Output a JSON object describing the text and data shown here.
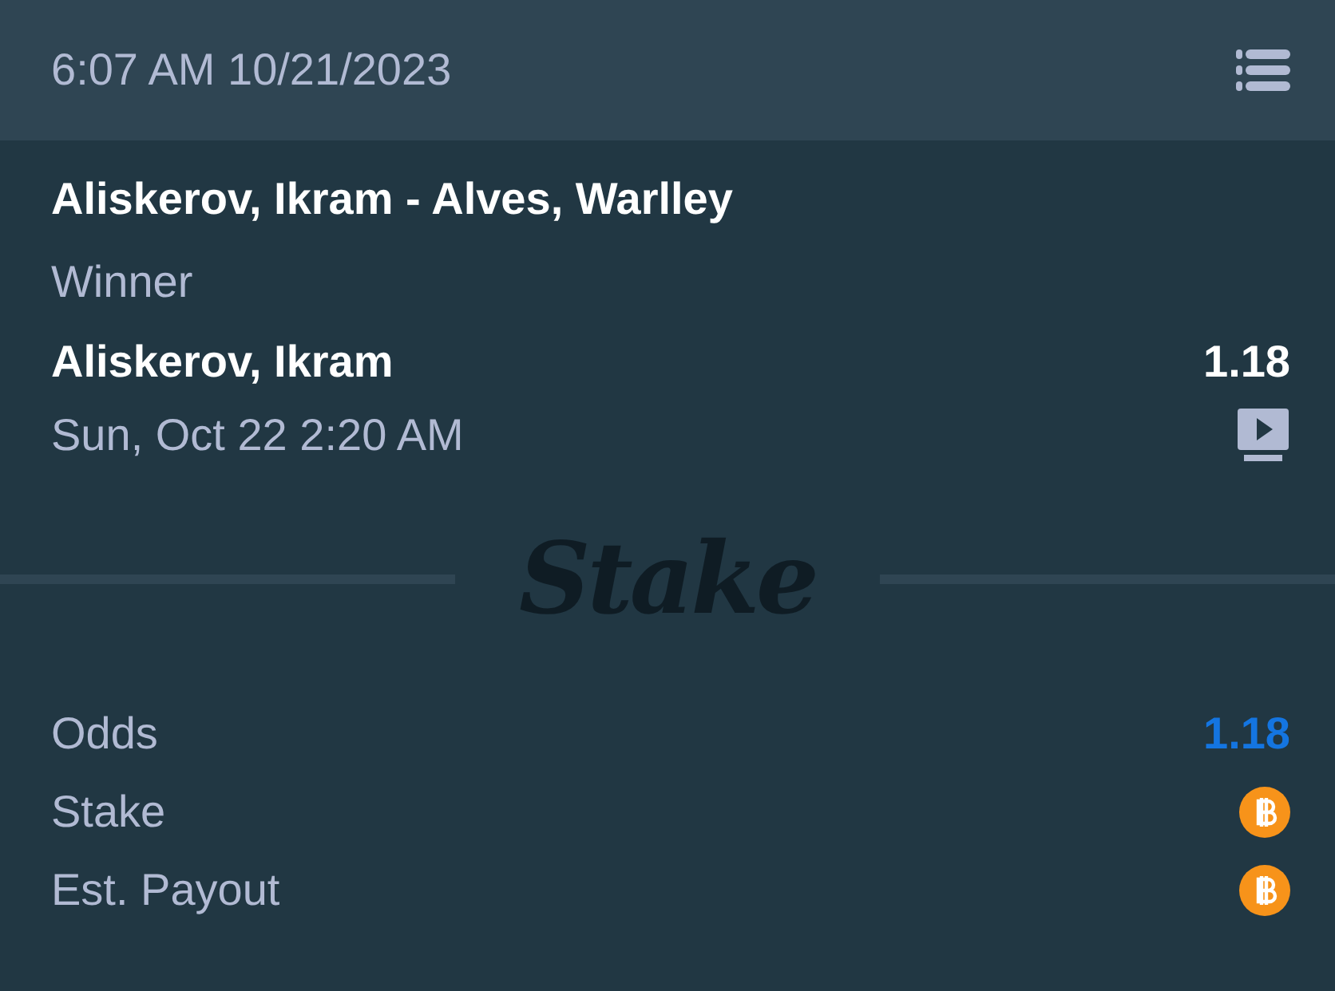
{
  "header": {
    "datetime": "6:07 AM 10/21/2023"
  },
  "bet": {
    "event": "Aliskerov, Ikram - Alves, Warlley",
    "market": "Winner",
    "selection": "Aliskerov, Ikram",
    "odds": "1.18",
    "start_time": "Sun, Oct 22 2:20 AM",
    "live_stream": true
  },
  "divider_logo": "Stake",
  "summary": [
    {
      "label": "Odds",
      "kind": "text",
      "value": "1.18"
    },
    {
      "label": "Stake",
      "kind": "currency"
    },
    {
      "label": "Est. Payout",
      "kind": "currency"
    }
  ]
}
